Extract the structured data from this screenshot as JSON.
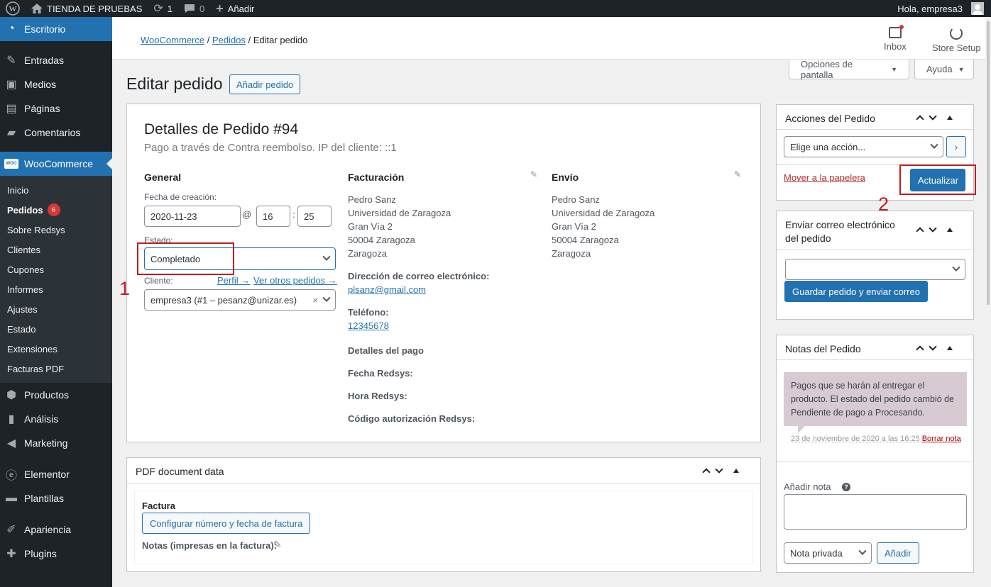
{
  "adminbar": {
    "site_name": "TIENDA DE PRUEBAS",
    "updates_count": "1",
    "comments_count": "0",
    "new_label": "Añadir",
    "greeting": "Hola, empresa3"
  },
  "sidebar": {
    "items_top": [
      {
        "label": "Escritorio"
      },
      {
        "label": "Entradas"
      },
      {
        "label": "Medios"
      },
      {
        "label": "Páginas"
      },
      {
        "label": "Comentarios"
      },
      {
        "label": "WooCommerce"
      }
    ],
    "submenu": [
      {
        "label": "Inicio"
      },
      {
        "label": "Pedidos",
        "count": "6"
      },
      {
        "label": "Sobre Redsys"
      },
      {
        "label": "Clientes"
      },
      {
        "label": "Cupones"
      },
      {
        "label": "Informes"
      },
      {
        "label": "Ajustes"
      },
      {
        "label": "Estado"
      },
      {
        "label": "Extensiones"
      },
      {
        "label": "Facturas PDF"
      }
    ],
    "items_bottom": [
      {
        "label": "Productos"
      },
      {
        "label": "Análisis"
      },
      {
        "label": "Marketing"
      },
      {
        "label": "Elementor"
      },
      {
        "label": "Plantillas"
      },
      {
        "label": "Apariencia"
      },
      {
        "label": "Plugins"
      }
    ]
  },
  "topbar": {
    "breadcrumb": [
      "WooCommerce",
      "Pedidos",
      "Editar pedido"
    ],
    "inbox_label": "Inbox",
    "store_setup_label": "Store Setup"
  },
  "screen_options": {
    "label": "Opciones de pantalla",
    "help": "Ayuda"
  },
  "page": {
    "title": "Editar pedido",
    "add_button": "Añadir pedido"
  },
  "order": {
    "title": "Detalles de Pedido #94",
    "subtitle": "Pago a través de Contra reembolso. IP del cliente: ::1",
    "general": {
      "heading": "General",
      "created_label": "Fecha de creación:",
      "date": "2020-11-23",
      "at": "@",
      "hour": "16",
      "colon": ":",
      "minute": "25",
      "status_label": "Estado:",
      "status": "Completado",
      "customer_label": "Cliente:",
      "profile_link": "Perfil →",
      "other_orders_link": "Ver otros pedidos →",
      "customer": "empresa3 (#1 – pesanz@unizar.es)",
      "clear": "×"
    },
    "billing": {
      "heading": "Facturación",
      "address": [
        "Pedro Sanz",
        "Universidad de Zaragoza",
        "Gran Vía 2",
        "50004 Zaragoza",
        "Zaragoza"
      ],
      "email_label": "Dirección de correo electrónico:",
      "email": "plsanz@gmail.com",
      "phone_label": "Teléfono:",
      "phone": "12345678",
      "payment_label": "Detalles del pago",
      "redsys_date": "Fecha Redsys:",
      "redsys_time": "Hora Redsys:",
      "redsys_auth": "Código autorización Redsys:"
    },
    "shipping": {
      "heading": "Envío",
      "address": [
        "Pedro Sanz",
        "Universidad de Zaragoza",
        "Gran Vía 2",
        "50004 Zaragoza",
        "Zaragoza"
      ]
    }
  },
  "pdf": {
    "title": "PDF document data",
    "section": "Factura",
    "config_button": "Configurar número y fecha de factura",
    "notes_label": "Notas (impresas en la factura):"
  },
  "actions": {
    "title": "Acciones del Pedido",
    "select": "Elige una acción...",
    "trash": "Mover a la papelera",
    "update": "Actualizar"
  },
  "email_box": {
    "title_line1": "Enviar correo electrónico",
    "title_line2": "del pedido",
    "button": "Guardar pedido y enviar correo"
  },
  "notes": {
    "title": "Notas del Pedido",
    "note_text": "Pagos que se harán al entregar el producto. El estado del pedido cambió de Pendiente de pago a Procesando.",
    "note_date": "23 de noviembre de 2020 a las 16:25",
    "delete": "Borrar nota",
    "add_label": "Añadir nota",
    "help": "?",
    "type": "Nota privada",
    "add_button": "Añadir"
  },
  "annotations": {
    "one": "1",
    "two": "2"
  }
}
